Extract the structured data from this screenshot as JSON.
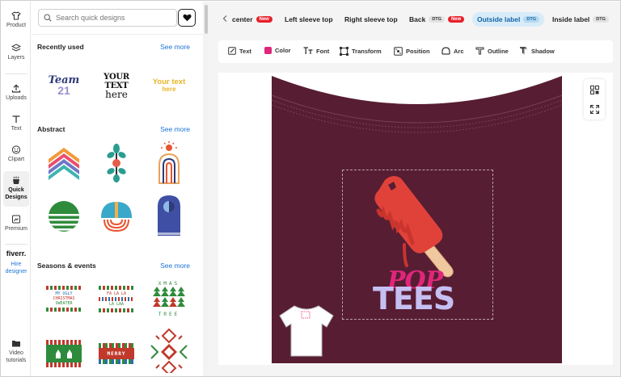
{
  "rail": {
    "items": [
      {
        "label": "Product",
        "icon": "shirt-icon"
      },
      {
        "label": "Layers",
        "icon": "layers-icon"
      },
      {
        "label": "Uploads",
        "icon": "upload-icon"
      },
      {
        "label": "Text",
        "icon": "text-icon"
      },
      {
        "label": "Clipart",
        "icon": "smiley-icon"
      },
      {
        "label": "Quick Designs",
        "icon": "quick-designs-icon"
      },
      {
        "label": "Premium",
        "icon": "premium-icon"
      }
    ],
    "fiverr": {
      "logo": "fiverr.",
      "link": "Hire designer"
    },
    "video": {
      "label": "Video tutorials",
      "icon": "folder-icon"
    }
  },
  "panel": {
    "search_placeholder": "Search quick designs",
    "sections": [
      {
        "title": "Recently used",
        "see_more": "See more"
      },
      {
        "title": "Abstract",
        "see_more": "See more"
      },
      {
        "title": "Seasons & events",
        "see_more": "See more"
      }
    ],
    "recent_tiles": {
      "team": {
        "line1": "Team",
        "line2": "21"
      },
      "your_text_1": {
        "line1": "YOUR TEXT",
        "line2": "here"
      },
      "your_text_2": {
        "line1": "Your text",
        "line2": "here"
      }
    },
    "season_tiles": {
      "sweater_1": {
        "lines": [
          "MY UGLY",
          "CHRISTMAS",
          "SWEATER"
        ]
      },
      "sweater_2": {
        "lines": [
          "FA LA LA",
          "LA LAA"
        ]
      },
      "sweater_3": {
        "lines": [
          "XMAS",
          "TREE"
        ]
      },
      "sweater_5": {
        "lines": [
          "MERRY"
        ]
      }
    }
  },
  "tabs": [
    {
      "label": "center",
      "badge": "New",
      "badge_type": "new"
    },
    {
      "label": "Left sleeve top",
      "badge": "",
      "badge_type": ""
    },
    {
      "label": "Right sleeve top",
      "badge": "",
      "badge_type": ""
    },
    {
      "label": "Back",
      "badge": "DTG",
      "badge_type": "dtg",
      "badge2": "New"
    },
    {
      "label": "Outside label",
      "badge": "DTG",
      "badge_type": "dtg",
      "selected": true
    },
    {
      "label": "Inside label",
      "badge": "DTG",
      "badge_type": "dtg"
    }
  ],
  "toolbar": [
    {
      "label": "Text",
      "icon": "edit-icon"
    },
    {
      "label": "Color",
      "icon": "color-swatch-icon"
    },
    {
      "label": "Font",
      "icon": "font-icon"
    },
    {
      "label": "Transform",
      "icon": "transform-icon"
    },
    {
      "label": "Position",
      "icon": "position-icon"
    },
    {
      "label": "Arc",
      "icon": "arc-icon"
    },
    {
      "label": "Outline",
      "icon": "outline-icon"
    },
    {
      "label": "Shadow",
      "icon": "shadow-icon"
    }
  ],
  "design": {
    "word1": "POP",
    "word2": "TEES"
  },
  "colors": {
    "shirt": "#571d33",
    "accent_blue": "#1a73d9",
    "new_badge": "#e8202a",
    "pink_swatch": "#e0267a",
    "selected_tab_bg": "#d7ecf8"
  }
}
